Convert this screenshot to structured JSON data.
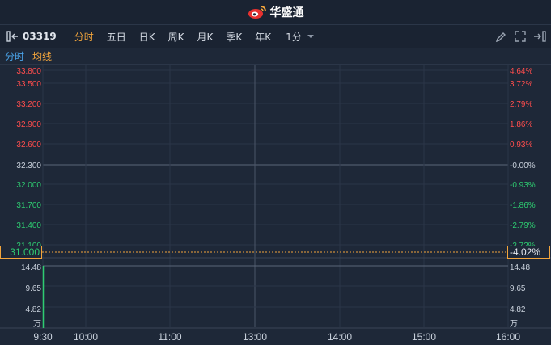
{
  "app": {
    "brand": "华盛通"
  },
  "toolbar": {
    "stock_code": "03319",
    "tabs": [
      "分时",
      "五日",
      "日K",
      "周K",
      "月K",
      "季K",
      "年K"
    ],
    "active_tab": 0,
    "interval": "1分"
  },
  "indicators": {
    "a": "分时",
    "b": "均线"
  },
  "colors": {
    "up": "#ff4d4d",
    "down": "#2ecc71",
    "neutral": "#c9d1dc",
    "accent": "#f2a53c",
    "blue": "#4aa3e8"
  },
  "chart_data": {
    "type": "line",
    "price_left_labels": [
      "33.800",
      "33.500",
      "33.200",
      "32.900",
      "32.600",
      "32.300",
      "32.000",
      "31.700",
      "31.400",
      "31.100"
    ],
    "pct_right_labels": [
      "4.64%",
      "3.72%",
      "2.79%",
      "1.86%",
      "0.93%",
      "-0.00%",
      "-0.93%",
      "-1.86%",
      "-2.79%",
      "-3.72%"
    ],
    "prev_close": 32.3,
    "current_price": "31.000",
    "current_pct": "-4.02%",
    "volume_labels": [
      "14.48",
      "9.65",
      "4.82"
    ],
    "volume_unit": "万",
    "time_labels": [
      "9:30",
      "10:00",
      "11:00",
      "13:00",
      "14:00",
      "15:00",
      "16:00"
    ]
  }
}
